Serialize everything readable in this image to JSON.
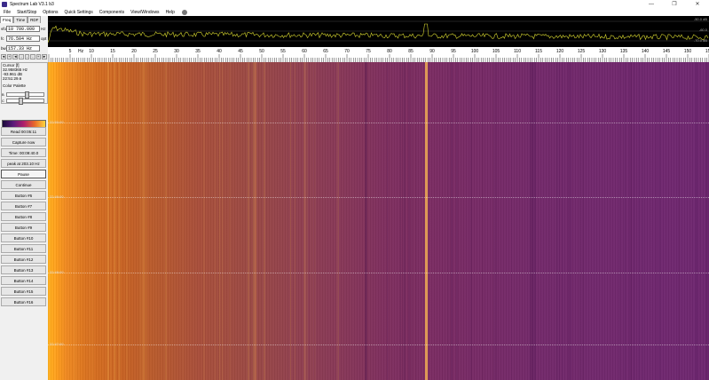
{
  "window": {
    "title": "Spectrum Lab V3.1 b3",
    "min": "—",
    "max": "❐",
    "close": "✕"
  },
  "menu": [
    "File",
    "Start/Stop",
    "Options",
    "Quick Settings",
    "Components",
    "View/Windows",
    "Help"
  ],
  "left_panel": {
    "tabs": [
      "Freq",
      "Time",
      "RDF"
    ],
    "fields": [
      {
        "label": "vfo",
        "value": "10 700.000",
        "unit": "Hz"
      },
      {
        "label": "fc",
        "value": "76.504 Hz",
        "unit": "opt"
      },
      {
        "label": "bw",
        "value": "157.33 Hz",
        "unit": ""
      }
    ],
    "step_buttons": [
      "◄",
      "+",
      "◄",
      "-",
      "-",
      "-",
      "+",
      "►"
    ],
    "cursor_info": {
      "title": "Cursor [f]",
      "freq": "32.958365 Hz",
      "level": "-93.961 dB",
      "time": "22:51:29.6",
      "palette_title": "Color Palette",
      "b_label": "B",
      "c_label": "C",
      "b_level": 0.55,
      "c_level": 0.35
    },
    "palette_min": "-100 dB",
    "palette_max": "-50",
    "buttons": [
      "Read 00:05:11",
      "Capture now",
      "Time: 00:09:40.0",
      "peak at 203.10 Hz",
      "Pause",
      "Continue",
      "Button #6",
      "Button #7",
      "Button #8",
      "Button #9",
      "Button #10",
      "Button #11",
      "Button #12",
      "Button #13",
      "Button #14",
      "Button #15",
      "Button #16"
    ]
  },
  "spectrum": {
    "label_top": "-50.0 dB",
    "label_mid": "-60.0",
    "label_bot": "-70.0 dB"
  },
  "scale": {
    "unit": "Hz",
    "ticks": [
      "5",
      "10",
      "15",
      "20",
      "25",
      "30",
      "35",
      "40",
      "45",
      "50",
      "55",
      "60",
      "65",
      "70",
      "75",
      "80",
      "85",
      "90",
      "95",
      "100",
      "105",
      "110",
      "115",
      "120",
      "125",
      "130",
      "135",
      "140",
      "145",
      "150",
      "155"
    ]
  },
  "waterfall": {
    "timestamps": [
      "22:50:00",
      "22:49:00",
      "22:48:00",
      "22:47:00"
    ]
  },
  "colors": {
    "panel_bg": "#f0f0f0",
    "spectrum_bg": "#000000",
    "trace": "#d8d830",
    "waterfall_hot": "#ffb020",
    "waterfall_cold": "#6e2670"
  }
}
